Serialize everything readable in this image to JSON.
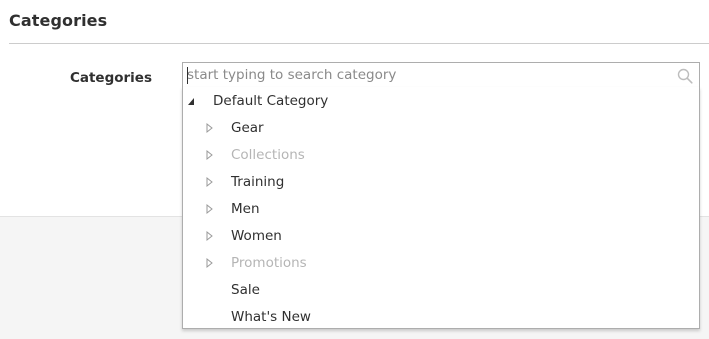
{
  "section": {
    "title": "Categories"
  },
  "field": {
    "label": "Categories"
  },
  "search": {
    "placeholder": "start typing to search category",
    "value": ""
  },
  "tree": {
    "root": {
      "label": "Default Category",
      "expanded": true
    },
    "children": [
      {
        "label": "Gear",
        "has_children": true,
        "enabled": true
      },
      {
        "label": "Collections",
        "has_children": true,
        "enabled": false
      },
      {
        "label": "Training",
        "has_children": true,
        "enabled": true
      },
      {
        "label": "Men",
        "has_children": true,
        "enabled": true
      },
      {
        "label": "Women",
        "has_children": true,
        "enabled": true
      },
      {
        "label": "Promotions",
        "has_children": true,
        "enabled": false
      },
      {
        "label": "Sale",
        "has_children": false,
        "enabled": true
      },
      {
        "label": "What's New",
        "has_children": false,
        "enabled": true
      }
    ]
  },
  "colors": {
    "text": "#303030",
    "disabled_text": "#b5b5b5",
    "border": "#adadad",
    "footer_bg": "#f5f5f5"
  },
  "icons": {
    "search": "search-icon",
    "expanded": "triangle-down-icon",
    "collapsed": "triangle-right-icon"
  }
}
